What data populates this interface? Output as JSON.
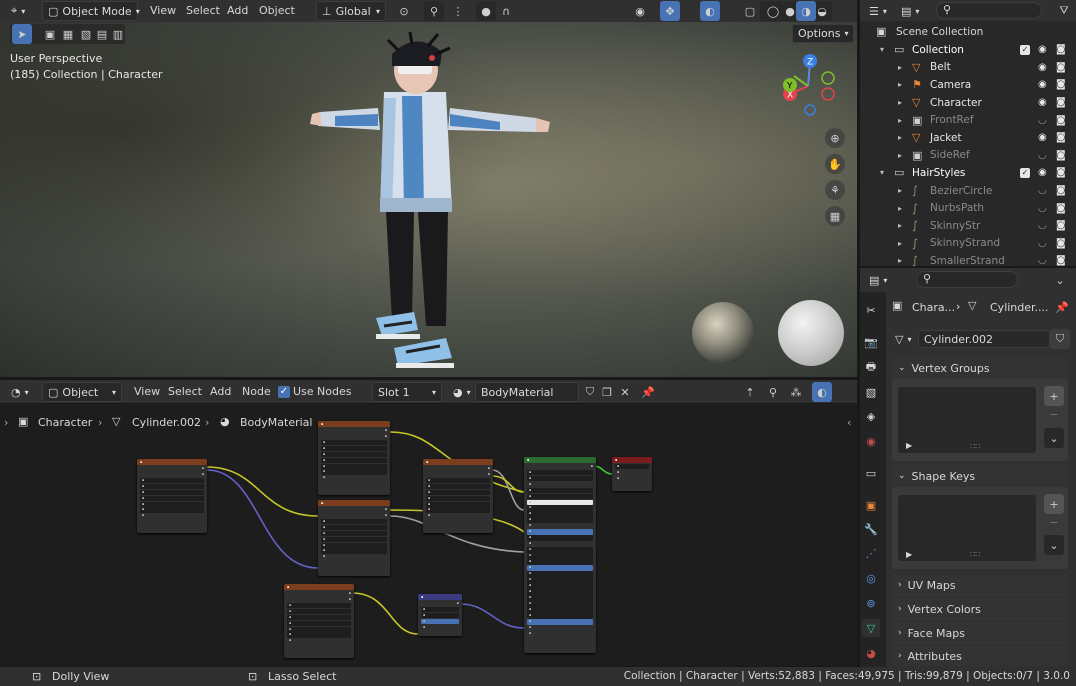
{
  "viewport_header": {
    "mode": "Object Mode",
    "menus": [
      "View",
      "Select",
      "Add",
      "Object"
    ],
    "transform_orientation": "Global",
    "options_label": "Options"
  },
  "viewport": {
    "perspective": "User Perspective",
    "collection_info": "(185) Collection | Character"
  },
  "outliner": {
    "search_placeholder": "",
    "scene_collection": "Scene Collection",
    "items": [
      {
        "label": "Collection",
        "kind": "collection",
        "depth": 1,
        "expand": "open",
        "color": "#ffffff",
        "muted": false
      },
      {
        "label": "Belt",
        "kind": "mesh",
        "depth": 2,
        "expand": "closed",
        "color": "#e6e6e6",
        "muted": false
      },
      {
        "label": "Camera",
        "kind": "camera",
        "depth": 2,
        "expand": "closed",
        "color": "#e6e6e6",
        "muted": false
      },
      {
        "label": "Character",
        "kind": "mesh",
        "depth": 2,
        "expand": "closed",
        "color": "#e6e6e6",
        "muted": false
      },
      {
        "label": "FrontRef",
        "kind": "empty",
        "depth": 2,
        "expand": "closed",
        "color": "#8a8a8a",
        "muted": true
      },
      {
        "label": "Jacket",
        "kind": "mesh",
        "depth": 2,
        "expand": "closed",
        "color": "#e6e6e6",
        "muted": false
      },
      {
        "label": "SideRef",
        "kind": "empty",
        "depth": 2,
        "expand": "closed",
        "color": "#8a8a8a",
        "muted": true
      },
      {
        "label": "HairStyles",
        "kind": "collection",
        "depth": 1,
        "expand": "open",
        "color": "#ffffff",
        "muted": false
      },
      {
        "label": "BezierCircle",
        "kind": "curve",
        "depth": 2,
        "expand": "closed",
        "color": "#8a8a8a",
        "muted": true
      },
      {
        "label": "NurbsPath",
        "kind": "curve",
        "depth": 2,
        "expand": "closed",
        "color": "#8a8a8a",
        "muted": true
      },
      {
        "label": "SkinnyStr",
        "kind": "curve",
        "depth": 2,
        "expand": "closed",
        "color": "#8a8a8a",
        "muted": true
      },
      {
        "label": "SkinnyStrand",
        "kind": "curve",
        "depth": 2,
        "expand": "closed",
        "color": "#8a8a8a",
        "muted": true
      },
      {
        "label": "SmallerStrand",
        "kind": "curve",
        "depth": 2,
        "expand": "closed",
        "color": "#8a8a8a",
        "muted": true
      }
    ]
  },
  "properties": {
    "breadcrumb_object": "Chara...",
    "breadcrumb_data": "Cylinder....",
    "data_name": "Cylinder.002",
    "panels": [
      "Vertex Groups",
      "Shape Keys",
      "UV Maps",
      "Vertex Colors",
      "Face Maps",
      "Attributes"
    ]
  },
  "node_editor": {
    "editor_type": "Object",
    "menus": [
      "View",
      "Select",
      "Add",
      "Node"
    ],
    "use_nodes_label": "Use Nodes",
    "slot": "Slot 1",
    "material": "BodyMaterial",
    "breadcrumb": [
      "Character",
      "Cylinder.002",
      "BodyMaterial"
    ]
  },
  "statusbar": {
    "left_hint": "Dolly View",
    "mid_hint": "Lasso Select",
    "stats": "Collection | Character | Verts:52,883 | Faces:49,975 | Tris:99,879 | Objects:0/7 | 3.0.0"
  },
  "colors": {
    "accent": "#4772b3",
    "mesh_icon": "#e7873a",
    "curve_icon": "#9c8f73",
    "node_image_header": "#7b3d1d",
    "node_shader_header": "#2b6b2f",
    "node_vector_header": "#3b3b82",
    "wire_yellow": "#c7c729",
    "wire_purple": "#6363c7",
    "wire_gray": "#a1a1a1"
  },
  "icons": [
    "editor-type-icon",
    "object-mode-icon",
    "global-orientation-icon",
    "pivot-icon",
    "snap-icon",
    "proportional-icon",
    "visibility-icon",
    "gizmo-icon",
    "overlay-icon",
    "xray-icon",
    "shading-wire-icon",
    "shading-solid-icon",
    "shading-material-icon",
    "shading-rendered-icon",
    "filter-icon",
    "eye-icon",
    "camera-render-icon",
    "pin-icon",
    "zoom-icon",
    "hand-icon",
    "camera-view-icon",
    "grid-icon",
    "wrench-icon",
    "material-icon"
  ]
}
